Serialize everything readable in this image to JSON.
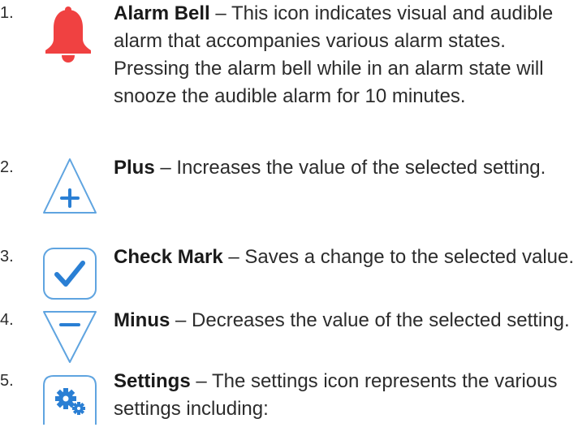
{
  "items": [
    {
      "number": "1.",
      "title": "Alarm Bell",
      "separator": " – ",
      "description": "This icon indicates visual and audible alarm that accompanies various alarm states. Pressing the alarm bell while in an alarm state will snooze the audible alarm for 10 minutes.",
      "icon": "alarm-bell-icon"
    },
    {
      "number": "2.",
      "title": "Plus",
      "separator": " – ",
      "description": "Increases the value of the selected setting.",
      "icon": "plus-icon"
    },
    {
      "number": "3.",
      "title": "Check Mark",
      "separator": " – ",
      "description": "Saves a change to the selected value.",
      "icon": "check-mark-icon"
    },
    {
      "number": "4.",
      "title": "Minus",
      "separator": " – ",
      "description": "Decreases the value of the selected setting.",
      "icon": "minus-icon"
    },
    {
      "number": "5.",
      "title": "Settings",
      "separator": " – ",
      "description": "The settings icon represents the various settings including:",
      "icon": "settings-icon"
    }
  ],
  "colors": {
    "alarm_red": "#f04141",
    "icon_blue": "#2a7fd4",
    "icon_outline": "#5fa4e0",
    "text": "#2c2c2c"
  }
}
